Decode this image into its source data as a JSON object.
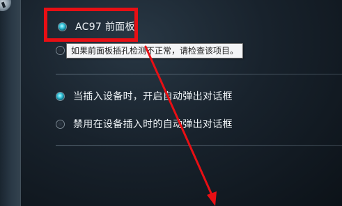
{
  "options": {
    "ac97_front_panel": {
      "label": "AC97 前面板",
      "selected": true
    },
    "second_option_label": "",
    "auto_popup_on_insert": {
      "label": "当插入设备时，开启自动弹出对话框",
      "selected": true
    },
    "disable_popup_on_insert": {
      "label": "禁用在设备插入时的自动弹出对话框",
      "selected": false
    }
  },
  "tooltip": {
    "text": "如果前面板插孔检测不正常，请检查该项目。"
  },
  "annotation": {
    "highlight_color": "#e80f14",
    "arrow_color": "#e80f14"
  },
  "colors": {
    "radio_selected": "#3ccbe0",
    "background": "#18222c"
  }
}
